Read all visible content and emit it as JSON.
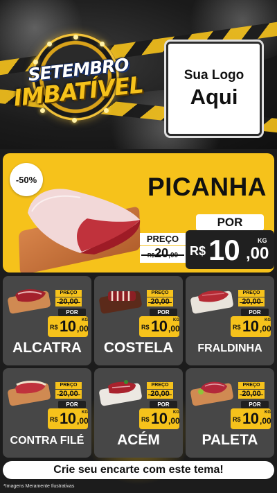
{
  "header": {
    "badge_line1": "SETEMBRO",
    "badge_line2": "IMBATÍVEL",
    "logo_line1": "Sua Logo",
    "logo_line2": "Aqui"
  },
  "featured": {
    "discount": "-50%",
    "name": "PICANHA",
    "from_label": "PREÇO",
    "from_currency": "R$",
    "from_int": "20",
    "from_cents": ",00",
    "por_label": "POR",
    "currency": "R$",
    "price_int": "10",
    "price_cents": ",00",
    "unit": "KG"
  },
  "products": [
    {
      "name": "ALCATRA",
      "from_label": "PREÇO",
      "from_price": "20,00",
      "por_label": "POR",
      "currency": "R$",
      "price_int": "10",
      "price_cents": ",00",
      "unit": "KG"
    },
    {
      "name": "COSTELA",
      "from_label": "PREÇO",
      "from_price": "20,00",
      "por_label": "POR",
      "currency": "R$",
      "price_int": "10",
      "price_cents": ",00",
      "unit": "KG"
    },
    {
      "name": "FRALDINHA",
      "from_label": "PREÇO",
      "from_price": "20,00",
      "por_label": "POR",
      "currency": "R$",
      "price_int": "10",
      "price_cents": ",00",
      "unit": "KG"
    },
    {
      "name": "CONTRA FILÉ",
      "from_label": "PREÇO",
      "from_price": "20,00",
      "por_label": "POR",
      "currency": "R$",
      "price_int": "10",
      "price_cents": ",00",
      "unit": "KG"
    },
    {
      "name": "ACÉM",
      "from_label": "PREÇO",
      "from_price": "20,00",
      "por_label": "POR",
      "currency": "R$",
      "price_int": "10",
      "price_cents": ",00",
      "unit": "KG"
    },
    {
      "name": "PALETA",
      "from_label": "PREÇO",
      "from_price": "20,00",
      "por_label": "POR",
      "currency": "R$",
      "price_int": "10",
      "price_cents": ",00",
      "unit": "KG"
    }
  ],
  "footer": {
    "cta": "Crie seu encarte com este tema!",
    "disclaimer": "*Imagens Meramente Ilustrativas"
  },
  "colors": {
    "accent": "#f6c21b",
    "dark": "#202020",
    "card": "#474747"
  }
}
